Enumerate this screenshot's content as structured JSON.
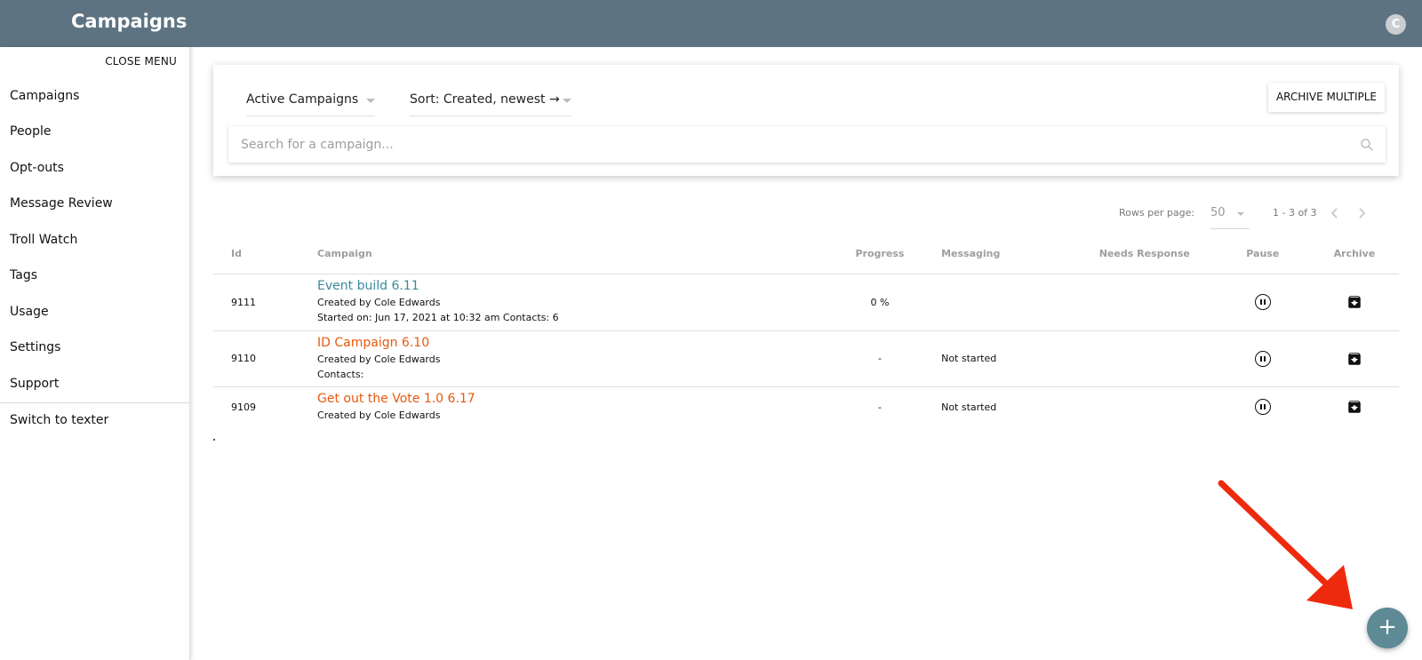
{
  "header": {
    "title": "Campaigns",
    "avatar_initial": "C"
  },
  "sidebar": {
    "close_label": "CLOSE MENU",
    "items": [
      {
        "label": "Campaigns"
      },
      {
        "label": "People"
      },
      {
        "label": "Opt-outs"
      },
      {
        "label": "Message Review"
      },
      {
        "label": "Troll Watch"
      },
      {
        "label": "Tags"
      },
      {
        "label": "Usage"
      },
      {
        "label": "Settings"
      },
      {
        "label": "Support"
      },
      {
        "label": "Switch to texter"
      }
    ]
  },
  "filters": {
    "status": "Active Campaigns",
    "sort": "Sort: Created, newest →",
    "archive_multiple": "ARCHIVE MULTIPLE",
    "search_placeholder": "Search for a campaign...",
    "search_value": ""
  },
  "pagination": {
    "rows_per_page_label": "Rows per page:",
    "rows_per_page": "50",
    "range": "1 - 3 of 3"
  },
  "table": {
    "columns": [
      "Id",
      "Campaign",
      "Progress",
      "Messaging",
      "Needs Response",
      "Pause",
      "Archive"
    ],
    "rows": [
      {
        "id": "9111",
        "name": "Event build 6.11",
        "created_by": "Created by Cole Edwards",
        "started": "Started on: Jun 17, 2021 at 10:32 am Contacts: 6",
        "progress": "0 %",
        "messaging": "",
        "needs_response": ""
      },
      {
        "id": "9110",
        "name": "ID Campaign 6.10",
        "created_by": "Created by Cole Edwards",
        "started": "Contacts:",
        "progress": "-",
        "messaging": "Not started",
        "needs_response": ""
      },
      {
        "id": "9109",
        "name": "Get out the Vote 1.0 6.17",
        "created_by": "Created by Cole Edwards",
        "started": "",
        "progress": "-",
        "messaging": "Not started",
        "needs_response": ""
      }
    ]
  },
  "fab": {
    "icon": "plus-icon",
    "label": "+"
  },
  "colors": {
    "topbar": "#5d7381",
    "link_teal": "#3a8a9e",
    "link_orange": "#e8590c",
    "annotation_arrow": "#ee2a0e",
    "fab": "#5d8a94"
  }
}
